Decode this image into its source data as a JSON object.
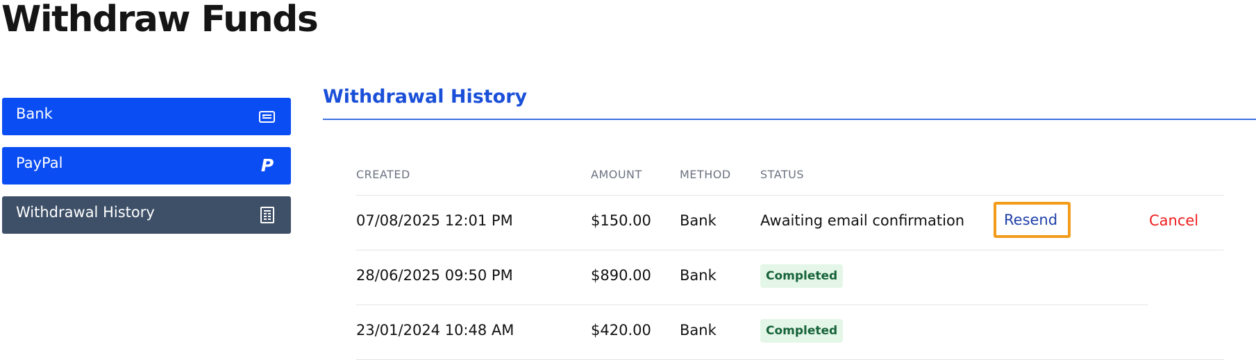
{
  "page": {
    "title": "Withdraw Funds"
  },
  "sidebar": {
    "items": [
      {
        "label": "Bank",
        "icon": "bank-card-icon",
        "active": false
      },
      {
        "label": "PayPal",
        "icon": "paypal-icon",
        "active": false
      },
      {
        "label": "Withdrawal History",
        "icon": "receipt-icon",
        "active": true
      }
    ]
  },
  "main": {
    "section_title": "Withdrawal History",
    "columns": [
      "CREATED",
      "AMOUNT",
      "METHOD",
      "STATUS"
    ],
    "rows": [
      {
        "created": "07/08/2025 12:01 PM",
        "amount": "$150.00",
        "method": "Bank",
        "status": "Awaiting email confirmation",
        "resend_label": "Resend",
        "cancel_label": "Cancel"
      },
      {
        "created": "28/06/2025 09:50 PM",
        "amount": "$890.00",
        "method": "Bank",
        "status": "Completed"
      },
      {
        "created": "23/01/2024 10:48 AM",
        "amount": "$420.00",
        "method": "Bank",
        "status": "Completed"
      }
    ]
  },
  "colors": {
    "nav_blue": "#0a4df2",
    "nav_active": "#3e5068",
    "accent": "#1a4fd8",
    "cancel": "#ef1c1c",
    "highlight": "#f39b1a",
    "completed_bg": "#e4f6e7",
    "completed_text": "#17633a"
  }
}
